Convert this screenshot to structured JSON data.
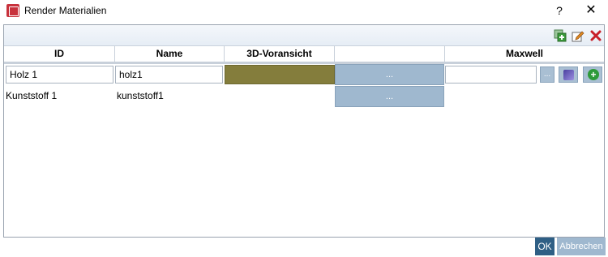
{
  "window": {
    "title": "Render Materialien",
    "help_label": "?",
    "close_label": "✕"
  },
  "toolbar": {
    "icons": [
      "add-icon",
      "edit-icon",
      "delete-icon"
    ]
  },
  "table": {
    "columns": [
      "ID",
      "Name",
      "3D-Voransicht",
      "",
      "Maxwell"
    ],
    "rows": [
      {
        "id": "Holz 1",
        "name": "holz1",
        "preview_color": "#847d3c",
        "button_label": "...",
        "maxwell_value": "",
        "maxwell_browse": "..."
      },
      {
        "id": "Kunststoff 1",
        "name": "kunststoff1",
        "button_label": "..."
      }
    ]
  },
  "footer": {
    "ok_label": "OK",
    "cancel_label": "Abbrechen"
  }
}
